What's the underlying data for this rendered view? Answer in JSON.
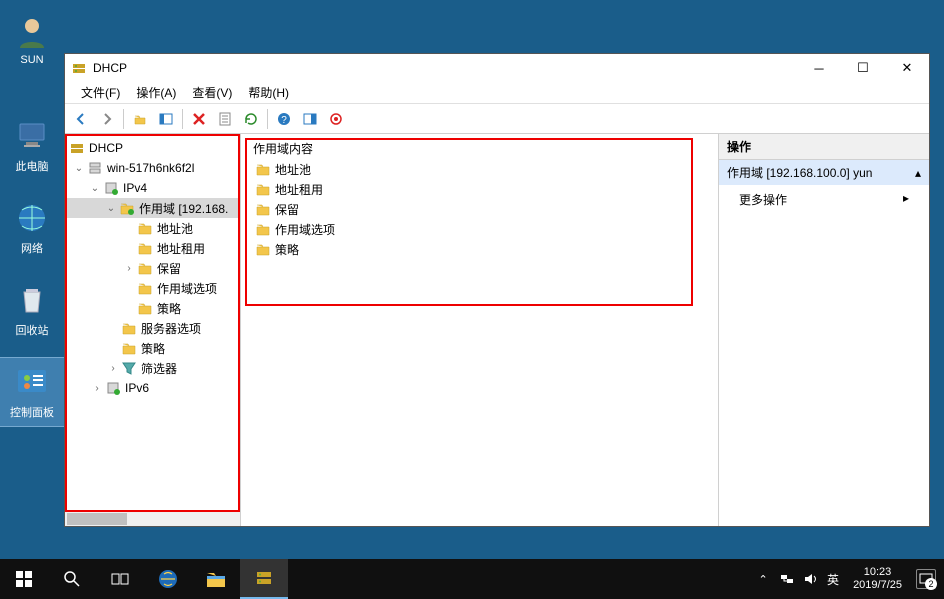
{
  "desktop": {
    "items": [
      {
        "label": "SUN"
      },
      {
        "label": "此电脑"
      },
      {
        "label": "网络"
      },
      {
        "label": "回收站"
      },
      {
        "label": "控制面板"
      }
    ]
  },
  "window": {
    "title": "DHCP",
    "menus": {
      "file": "文件(F)",
      "action": "操作(A)",
      "view": "查看(V)",
      "help": "帮助(H)"
    }
  },
  "tree": {
    "root": "DHCP",
    "server": "win-517h6nk6f2l",
    "ipv4": "IPv4",
    "scope": "作用域 [192.168.",
    "scope_children": [
      "地址池",
      "地址租用",
      "保留",
      "作用域选项",
      "策略"
    ],
    "server_options": "服务器选项",
    "policies": "策略",
    "filters": "筛选器",
    "ipv6": "IPv6"
  },
  "list": {
    "header": "作用域内容",
    "items": [
      "地址池",
      "地址租用",
      "保留",
      "作用域选项",
      "策略"
    ]
  },
  "actions": {
    "header": "操作",
    "scope_label": "作用域 [192.168.100.0] yun",
    "more": "更多操作"
  },
  "taskbar": {
    "ime": "英",
    "time": "10:23",
    "date": "2019/7/25",
    "notif_count": "2"
  }
}
